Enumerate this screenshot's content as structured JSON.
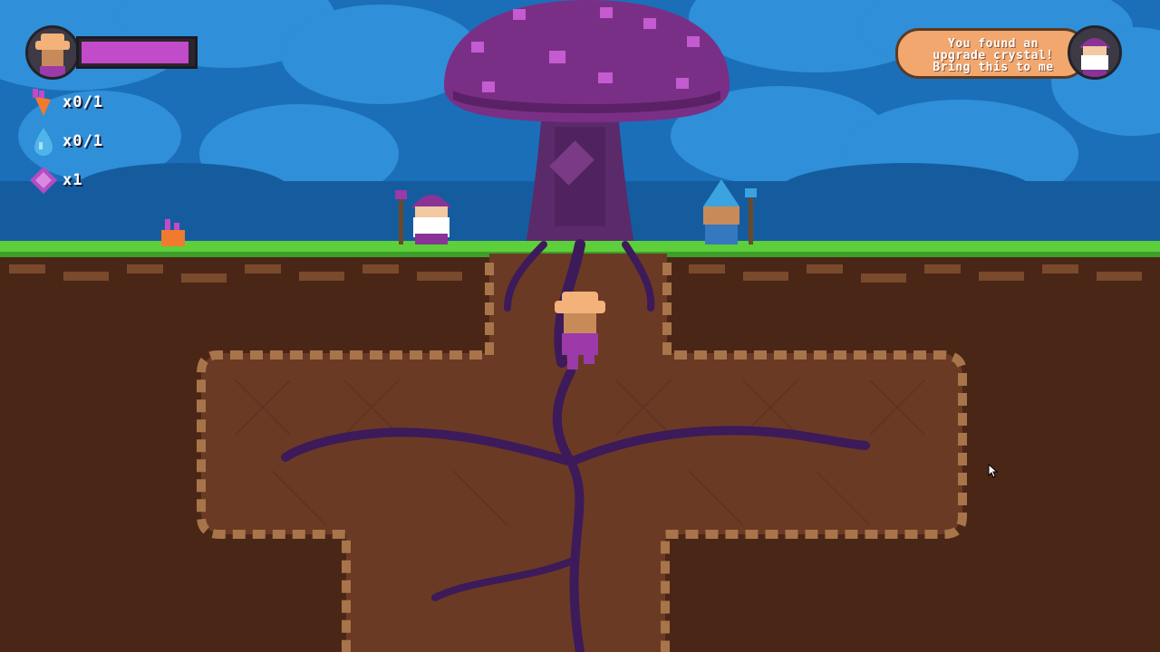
{
  "hud": {
    "health_fraction": 0.97,
    "inventory": [
      {
        "item": "carrot-icon",
        "count": "x0/1",
        "color": "#f07a2e"
      },
      {
        "item": "water-drop-icon",
        "count": "x0/1",
        "color": "#4fb4ea"
      },
      {
        "item": "purple-crystal-icon",
        "count": "x1",
        "color": "#b54cc4"
      }
    ]
  },
  "dialog": {
    "lines": [
      "You found an",
      "upgrade crystal!",
      "Bring this to me"
    ]
  },
  "colors": {
    "sky": "#1a6fb8",
    "grass": "#5ccf3b",
    "dirt": "#5a2f1d",
    "mushroom_cap": "#7a2f86",
    "roots": "#3d1a5a",
    "health": "#c14bc8"
  }
}
